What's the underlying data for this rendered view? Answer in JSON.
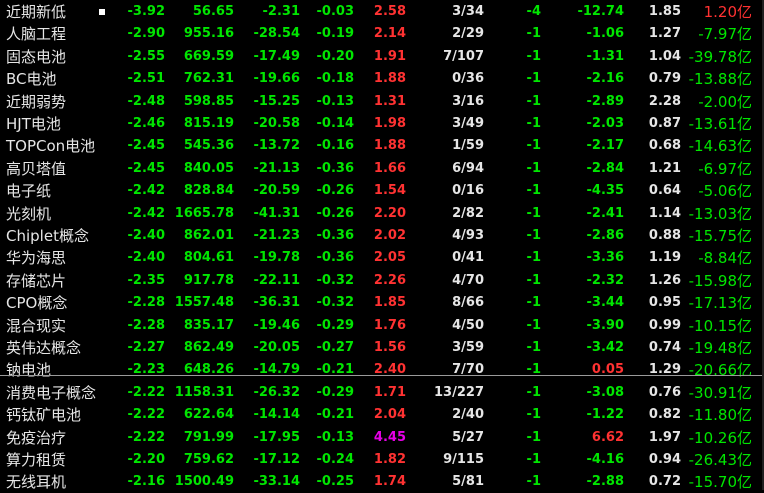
{
  "colors": {
    "up": "#ff3232",
    "down": "#00e600",
    "neutral": "#e6e6e6",
    "highlight": "#e600e6"
  },
  "rows": [
    {
      "name": "近期新低",
      "marked": true,
      "cols": [
        "-3.92",
        "56.65",
        "-2.31",
        "-0.03",
        "2.58",
        "3/34",
        "-4",
        "-12.74",
        "1.85",
        "1.20亿"
      ],
      "c5": "up",
      "c8": "down",
      "c10": "up"
    },
    {
      "name": "人脑工程",
      "cols": [
        "-2.90",
        "955.16",
        "-28.54",
        "-0.19",
        "2.14",
        "2/29",
        "-1",
        "-1.06",
        "1.27",
        "-7.97亿"
      ],
      "c5": "up",
      "c8": "down",
      "c10": "down"
    },
    {
      "name": "固态电池",
      "cols": [
        "-2.55",
        "669.59",
        "-17.49",
        "-0.20",
        "1.91",
        "7/107",
        "-1",
        "-1.31",
        "1.04",
        "-39.78亿"
      ],
      "c5": "up",
      "c8": "down",
      "c10": "down"
    },
    {
      "name": "BC电池",
      "cols": [
        "-2.51",
        "762.31",
        "-19.66",
        "-0.18",
        "1.88",
        "0/36",
        "-1",
        "-2.16",
        "0.79",
        "-13.88亿"
      ],
      "c5": "up",
      "c8": "down",
      "c10": "down"
    },
    {
      "name": "近期弱势",
      "cols": [
        "-2.48",
        "598.85",
        "-15.25",
        "-0.13",
        "1.31",
        "3/16",
        "-1",
        "-2.89",
        "2.28",
        "-2.00亿"
      ],
      "c5": "up",
      "c8": "down",
      "c10": "down"
    },
    {
      "name": "HJT电池",
      "cols": [
        "-2.46",
        "815.19",
        "-20.58",
        "-0.14",
        "1.98",
        "3/49",
        "-1",
        "-2.03",
        "0.87",
        "-13.61亿"
      ],
      "c5": "up",
      "c8": "down",
      "c10": "down"
    },
    {
      "name": "TOPCon电池",
      "cols": [
        "-2.45",
        "545.36",
        "-13.72",
        "-0.16",
        "1.88",
        "1/59",
        "-1",
        "-2.17",
        "0.68",
        "-14.63亿"
      ],
      "c5": "up",
      "c8": "down",
      "c10": "down"
    },
    {
      "name": "高贝塔值",
      "cols": [
        "-2.45",
        "840.05",
        "-21.13",
        "-0.36",
        "1.66",
        "6/94",
        "-1",
        "-2.84",
        "1.21",
        "-6.97亿"
      ],
      "c5": "up",
      "c8": "down",
      "c10": "down"
    },
    {
      "name": "电子纸",
      "cols": [
        "-2.42",
        "828.84",
        "-20.59",
        "-0.26",
        "1.54",
        "0/16",
        "-1",
        "-4.35",
        "0.64",
        "-5.06亿"
      ],
      "c5": "up",
      "c8": "down",
      "c10": "down"
    },
    {
      "name": "光刻机",
      "cols": [
        "-2.42",
        "1665.78",
        "-41.31",
        "-0.26",
        "2.20",
        "2/82",
        "-1",
        "-2.41",
        "1.14",
        "-13.03亿"
      ],
      "c5": "up",
      "c8": "down",
      "c10": "down"
    },
    {
      "name": "Chiplet概念",
      "cols": [
        "-2.40",
        "862.01",
        "-21.23",
        "-0.36",
        "2.02",
        "4/93",
        "-1",
        "-2.86",
        "0.88",
        "-15.75亿"
      ],
      "c5": "up",
      "c8": "down",
      "c10": "down"
    },
    {
      "name": "华为海思",
      "cols": [
        "-2.40",
        "804.61",
        "-19.78",
        "-0.36",
        "2.05",
        "0/41",
        "-1",
        "-3.36",
        "1.19",
        "-8.84亿"
      ],
      "c5": "up",
      "c8": "down",
      "c10": "down"
    },
    {
      "name": "存储芯片",
      "cols": [
        "-2.35",
        "917.78",
        "-22.11",
        "-0.32",
        "2.26",
        "4/70",
        "-1",
        "-2.32",
        "1.26",
        "-15.98亿"
      ],
      "c5": "up",
      "c8": "down",
      "c10": "down"
    },
    {
      "name": "CPO概念",
      "cols": [
        "-2.28",
        "1557.48",
        "-36.31",
        "-0.32",
        "1.85",
        "8/66",
        "-1",
        "-3.44",
        "0.95",
        "-17.13亿"
      ],
      "c5": "up",
      "c8": "down",
      "c10": "down"
    },
    {
      "name": "混合现实",
      "cols": [
        "-2.28",
        "835.17",
        "-19.46",
        "-0.29",
        "1.76",
        "4/50",
        "-1",
        "-3.90",
        "0.99",
        "-10.15亿"
      ],
      "c5": "up",
      "c8": "down",
      "c10": "down"
    },
    {
      "name": "英伟达概念",
      "cols": [
        "-2.27",
        "862.49",
        "-20.05",
        "-0.27",
        "1.56",
        "3/59",
        "-1",
        "-3.42",
        "0.74",
        "-19.48亿"
      ],
      "c5": "up",
      "c8": "down",
      "c10": "down"
    },
    {
      "name": "钠电池",
      "cols": [
        "-2.23",
        "648.26",
        "-14.79",
        "-0.21",
        "2.40",
        "7/70",
        "-1",
        "0.05",
        "1.29",
        "-20.66亿"
      ],
      "c5": "up",
      "c8": "up",
      "c10": "down"
    },
    {
      "name": "消费电子概念",
      "cols": [
        "-2.22",
        "1158.31",
        "-26.32",
        "-0.29",
        "1.71",
        "13/227",
        "-1",
        "-3.08",
        "0.76",
        "-30.91亿"
      ],
      "c5": "up",
      "c8": "down",
      "c10": "down"
    },
    {
      "name": "钙钛矿电池",
      "cols": [
        "-2.22",
        "622.64",
        "-14.14",
        "-0.21",
        "2.04",
        "2/40",
        "-1",
        "-1.22",
        "0.82",
        "-11.80亿"
      ],
      "c5": "up",
      "c8": "down",
      "c10": "down"
    },
    {
      "name": "免疫治疗",
      "cols": [
        "-2.22",
        "791.99",
        "-17.95",
        "-0.13",
        "4.45",
        "5/27",
        "-1",
        "6.62",
        "1.97",
        "-10.26亿"
      ],
      "c5": "highlight",
      "c8": "up",
      "c10": "down"
    },
    {
      "name": "算力租赁",
      "cols": [
        "-2.20",
        "759.62",
        "-17.12",
        "-0.24",
        "1.82",
        "9/115",
        "-1",
        "-4.16",
        "0.94",
        "-26.43亿"
      ],
      "c5": "up",
      "c8": "down",
      "c10": "down"
    },
    {
      "name": "无线耳机",
      "cols": [
        "-2.16",
        "1500.49",
        "-33.14",
        "-0.25",
        "1.74",
        "5/81",
        "-1",
        "-2.88",
        "0.72",
        "-15.70亿"
      ],
      "c5": "up",
      "c8": "down",
      "c10": "down"
    }
  ]
}
